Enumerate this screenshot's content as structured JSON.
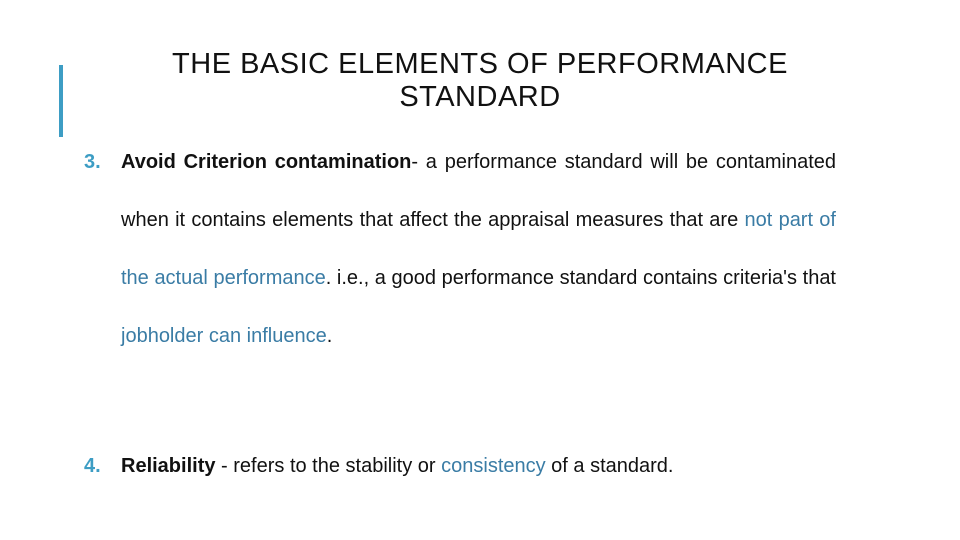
{
  "slide": {
    "title_lines": [
      "THE BASIC ELEMENTS OF PERFORMANCE",
      "STANDARD"
    ],
    "accent_color": "#3d9dc4",
    "highlight_color": "#3a7ca5",
    "items": [
      {
        "number": "3.",
        "heading": "Avoid Criterion contamination",
        "text_1": "- a performance standard will be contaminated when it contains elements that affect the appraisal measures that are ",
        "highlight_1": "not part of the actual performance",
        "text_2": ". i.e., a good performance standard contains criteria's that ",
        "highlight_2": "jobholder can influence",
        "text_3": "."
      },
      {
        "number": "4.",
        "heading": "Reliability",
        "text_1": " - refers to the stability or ",
        "highlight_1": "consistency",
        "text_2": " of a standard."
      }
    ]
  }
}
